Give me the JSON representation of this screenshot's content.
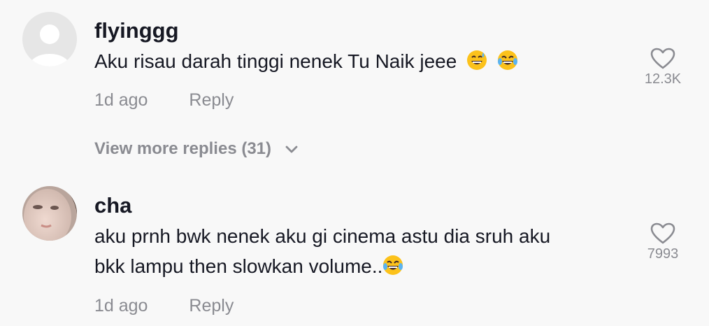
{
  "comments": [
    {
      "username": "flyinggg",
      "text": "Aku risau darah tinggi nenek Tu Naik jeee",
      "emojis": [
        "grinning-sweat-emoji",
        "tears-of-joy-emoji"
      ],
      "time": "1d ago",
      "reply_label": "Reply",
      "likes": "12.3K",
      "avatar": "default-avatar-icon"
    },
    {
      "username": "cha",
      "text_line1": "aku prnh bwk nenek aku gi cinema astu dia sruh aku",
      "text_line2": "bkk lampu then slowkan volume..",
      "emojis": [
        "tears-of-joy-emoji"
      ],
      "time": "1d ago",
      "reply_label": "Reply",
      "likes": "7993",
      "avatar": "user-photo-avatar"
    }
  ],
  "view_more": "View more replies (31)",
  "colors": {
    "background": "#f8f8f8",
    "primary_text": "#161823",
    "secondary_text": "#8a8b91"
  }
}
